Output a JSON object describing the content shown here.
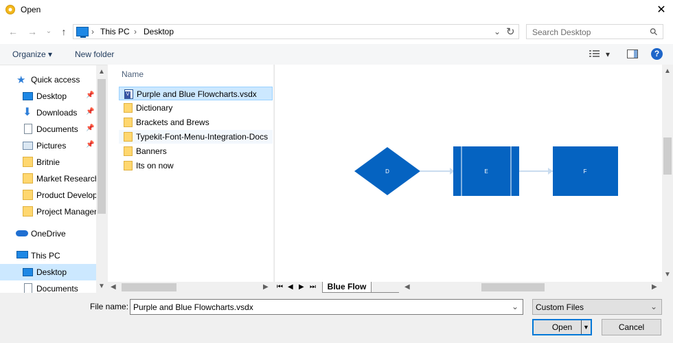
{
  "window": {
    "title": "Open"
  },
  "nav": {
    "back": "←",
    "forward": "→",
    "recent": "⌄",
    "up": "↑",
    "breadcrumb": [
      "This PC",
      "Desktop"
    ],
    "separator": "›",
    "dropdown": "⌄",
    "refresh": "↻"
  },
  "search": {
    "placeholder": "Search Desktop",
    "icon": "⚲"
  },
  "toolbar": {
    "organize": "Organize ▾",
    "new_folder": "New folder",
    "view_menu": "▾"
  },
  "sidebar": {
    "quick_access": "Quick access",
    "items": [
      {
        "label": "Desktop",
        "pinned": true
      },
      {
        "label": "Downloads",
        "pinned": true
      },
      {
        "label": "Documents",
        "pinned": true
      },
      {
        "label": "Pictures",
        "pinned": true
      },
      {
        "label": "Britnie"
      },
      {
        "label": "Market Research"
      },
      {
        "label": "Product Develop"
      },
      {
        "label": "Project Manager"
      }
    ],
    "onedrive": "OneDrive",
    "this_pc": "This PC",
    "pc_items": [
      "Desktop",
      "Documents"
    ]
  },
  "files": {
    "column_name": "Name",
    "items": [
      {
        "label": "Purple and Blue Flowcharts.vsdx",
        "type": "visio",
        "selected": true
      },
      {
        "label": "Dictionary",
        "type": "folder"
      },
      {
        "label": "Brackets and Brews",
        "type": "folder"
      },
      {
        "label": "Typekit-Font-Menu-Integration-Docs",
        "type": "folder"
      },
      {
        "label": "Banners",
        "type": "folder"
      },
      {
        "label": "Its on now",
        "type": "folder"
      }
    ]
  },
  "preview": {
    "shapes": [
      {
        "label": "D",
        "kind": "diamond"
      },
      {
        "label": "E",
        "kind": "process"
      },
      {
        "label": "F",
        "kind": "rect"
      }
    ],
    "colors": {
      "shape": "#0563c1",
      "connector": "#c9dcef"
    }
  },
  "sheet": {
    "tab": "Blue Flow"
  },
  "footer": {
    "file_name_label": "File name:",
    "file_name_value": "Purple and Blue Flowcharts.vsdx",
    "file_type": "Custom Files",
    "open_label": "Open",
    "cancel_label": "Cancel"
  }
}
